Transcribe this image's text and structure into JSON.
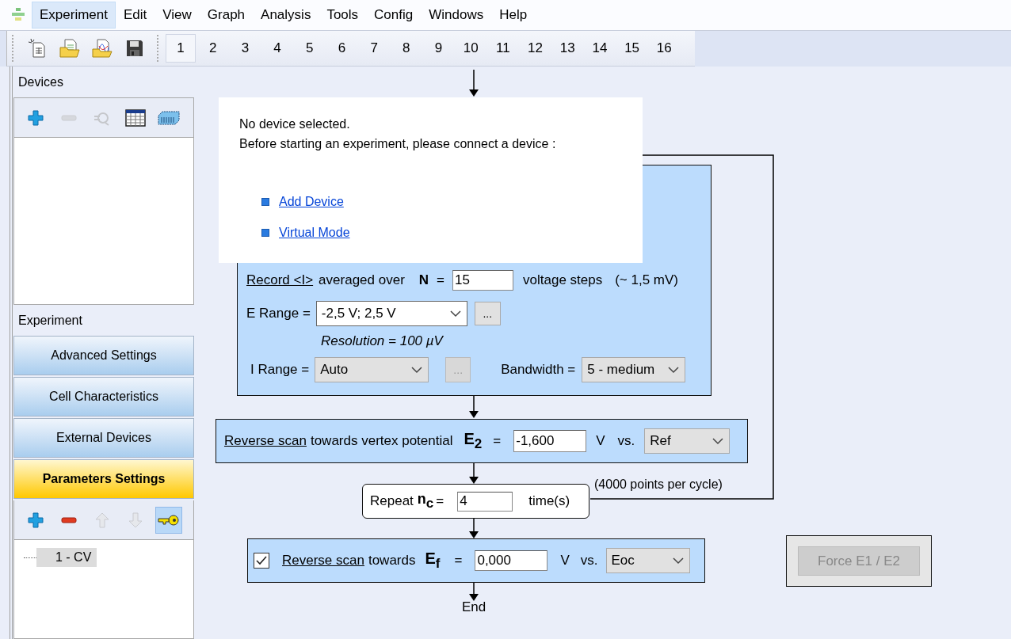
{
  "menu_bar": {
    "items": [
      {
        "label": "Experiment",
        "selected": true
      },
      {
        "label": "Edit",
        "selected": false
      },
      {
        "label": "View",
        "selected": false
      },
      {
        "label": "Graph",
        "selected": false
      },
      {
        "label": "Analysis",
        "selected": false
      },
      {
        "label": "Tools",
        "selected": false
      },
      {
        "label": "Config",
        "selected": false
      },
      {
        "label": "Windows",
        "selected": false
      },
      {
        "label": "Help",
        "selected": false
      }
    ]
  },
  "toolbar": {
    "buttons": [
      {
        "kind": "new"
      },
      {
        "kind": "open"
      },
      {
        "kind": "open_graph"
      },
      {
        "kind": "save"
      }
    ],
    "pages": [
      {
        "label": "1",
        "selected": true
      },
      {
        "label": "2",
        "selected": false
      },
      {
        "label": "3",
        "selected": false
      },
      {
        "label": "4",
        "selected": false
      },
      {
        "label": "5",
        "selected": false
      },
      {
        "label": "6",
        "selected": false
      },
      {
        "label": "7",
        "selected": false
      },
      {
        "label": "8",
        "selected": false
      },
      {
        "label": "9",
        "selected": false
      },
      {
        "label": "10",
        "selected": false
      },
      {
        "label": "11",
        "selected": false
      },
      {
        "label": "12",
        "selected": false
      },
      {
        "label": "13",
        "selected": false
      },
      {
        "label": "14",
        "selected": false
      },
      {
        "label": "15",
        "selected": false
      },
      {
        "label": "16",
        "selected": false
      }
    ]
  },
  "devices": {
    "title": "Devices",
    "tools": [
      {
        "kind": "add",
        "disabled": false,
        "on": false
      },
      {
        "kind": "remove",
        "disabled": true,
        "on": false
      },
      {
        "kind": "connect",
        "disabled": true,
        "on": false
      },
      {
        "kind": "table",
        "disabled": false,
        "on": false
      },
      {
        "kind": "hardware",
        "disabled": false,
        "on": false
      }
    ]
  },
  "experiment": {
    "title": "Experiment",
    "sections": [
      {
        "label": "Advanced Settings",
        "selected": false
      },
      {
        "label": "Cell Characteristics",
        "selected": false
      },
      {
        "label": "External Devices",
        "selected": false
      },
      {
        "label": "Parameters Settings",
        "selected": true
      }
    ],
    "tools": [
      {
        "kind": "add",
        "disabled": false,
        "on": false
      },
      {
        "kind": "remove",
        "disabled": false,
        "on": false
      },
      {
        "kind": "up",
        "disabled": true,
        "on": false
      },
      {
        "kind": "down",
        "disabled": true,
        "on": false
      },
      {
        "kind": "key",
        "disabled": false,
        "on": true
      }
    ],
    "tree": [
      {
        "label": "1 - CV",
        "selected": true
      }
    ]
  },
  "popup": {
    "lines": [
      "No device selected.",
      "Before starting an experiment, please connect a device :"
    ],
    "links": [
      "Add Device",
      "Virtual Mode"
    ]
  },
  "scan_block": {
    "record_link": "Record <I>",
    "averaged_text": "averaged over",
    "n_symbol": "N",
    "equals": "=",
    "n_value": "15",
    "steps_text": "voltage steps",
    "step_note": "(~ 1,5 mV)",
    "e_range_label": "E Range =",
    "e_range": {
      "value": "-2,5 V; 2,5 V",
      "editable": true
    },
    "e_range_more": {
      "label": "...",
      "disabled": false
    },
    "resolution": "Resolution = 100 µV",
    "i_range_label": "I Range =",
    "i_range": {
      "value": "Auto",
      "editable": false
    },
    "i_range_more": {
      "label": "...",
      "disabled": true
    },
    "bandwidth_label": "Bandwidth =",
    "bandwidth": {
      "value": "5 - medium",
      "editable": false
    }
  },
  "reverse_vertex": {
    "link": "Reverse scan",
    "text": "towards vertex potential",
    "symbol": "E$_{2}$",
    "equals": "=",
    "value": "-1,600",
    "unit": "V",
    "vs": "vs.",
    "reference": {
      "value": "Ref",
      "editable": false
    }
  },
  "repeat": {
    "label": "Repeat",
    "symbol": "n$_{c}$",
    "equals": "=",
    "value": "4",
    "unit": "time(s)",
    "note": "(4000 points per cycle)"
  },
  "final_scan": {
    "checked": true,
    "link": "Reverse scan",
    "text": "towards",
    "symbol": "E$_{f}$",
    "equals": "=",
    "value": "0,000",
    "unit": "V",
    "vs": "vs.",
    "reference": {
      "value": "Eoc",
      "editable": false
    }
  },
  "end_label": "End",
  "force_button": {
    "label": "Force E1 / E2",
    "disabled": true
  }
}
